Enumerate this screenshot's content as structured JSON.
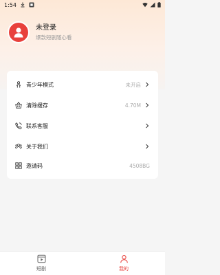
{
  "status_bar": {
    "time": "1:54",
    "icons": [
      "download-icon",
      "app-notification-icon",
      "wifi-icon",
      "signal-icon",
      "battery-icon"
    ]
  },
  "profile": {
    "name": "未登录",
    "subtitle": "爆款短剧随心看",
    "avatar_color": "#e8413c"
  },
  "menu": {
    "items": [
      {
        "label": "青少年模式",
        "value": "未开启",
        "icon": "person-icon",
        "has_arrow": true
      },
      {
        "label": "清除缓存",
        "value": "4.70M",
        "icon": "basket-icon",
        "has_arrow": true
      },
      {
        "label": "联系客服",
        "value": "",
        "icon": "phone-icon",
        "has_arrow": true
      },
      {
        "label": "关于我们",
        "value": "",
        "icon": "group-icon",
        "has_arrow": true
      },
      {
        "label": "邀请码",
        "value": "4508BG",
        "icon": "qr-grid-icon",
        "has_arrow": false
      }
    ]
  },
  "tabbar": {
    "tabs": [
      {
        "label": "短剧",
        "icon": "video-icon",
        "active": false
      },
      {
        "label": "我的",
        "icon": "profile-icon",
        "active": true
      }
    ],
    "active_color": "#e8413c",
    "inactive_color": "#666666"
  }
}
